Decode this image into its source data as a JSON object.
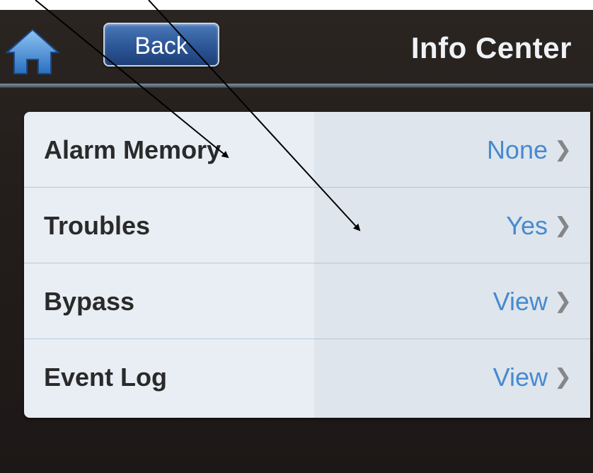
{
  "header": {
    "home_icon": "home-icon",
    "back_label": "Back",
    "title": "Info Center"
  },
  "colors": {
    "background": "#231d1b",
    "back_button": "#2c5696",
    "value_text": "#2f7fd4",
    "label_text": "#2a2a2a"
  },
  "rows": [
    {
      "label": "Alarm Memory",
      "value": "None",
      "icon": "chevron-right-icon"
    },
    {
      "label": "Troubles",
      "value": "Yes",
      "icon": "chevron-right-icon"
    },
    {
      "label": "Bypass",
      "value": "View",
      "icon": "chevron-right-icon"
    },
    {
      "label": "Event Log",
      "value": "View",
      "icon": "chevron-right-icon"
    }
  ]
}
